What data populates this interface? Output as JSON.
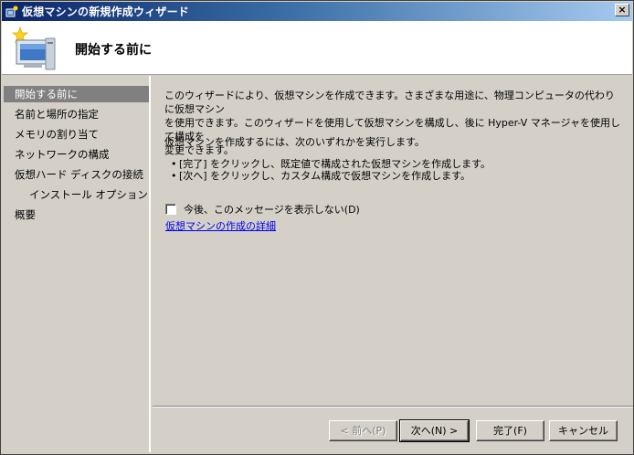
{
  "window": {
    "title": "仮想マシンの新規作成ウィザード",
    "close_label": "×"
  },
  "header": {
    "title": "開始する前に"
  },
  "nav": {
    "items": [
      {
        "label": "開始する前に"
      },
      {
        "label": "名前と場所の指定"
      },
      {
        "label": "メモリの割り当て"
      },
      {
        "label": "ネットワークの構成"
      },
      {
        "label": "仮想ハード ディスクの接続"
      },
      {
        "label": "インストール オプション"
      },
      {
        "label": "概要"
      }
    ]
  },
  "content": {
    "intro_line1": "このウィザードにより、仮想マシンを作成できます。さまざまな用途に、物理コンピュータの代わりに仮想マシン",
    "intro_line2": "を使用できます。このウィザードを使用して仮想マシンを構成し、後に Hyper-V マネージャを使用して構成を",
    "intro_line3": "変更できます。",
    "instruction": "仮想マシンを作成するには、次のいずれかを実行します。",
    "bullets": [
      "[完了] をクリックし、既定値で構成された仮想マシンを作成します。",
      "[次へ] をクリックし、カスタム構成で仮想マシンを作成します。"
    ],
    "checkbox_label": "今後、このメッセージを表示しない(D)",
    "details_link": "仮想マシンの作成の詳細"
  },
  "buttons": {
    "back": "< 前へ(P)",
    "next": "次へ(N) >",
    "finish": "完了(F)",
    "cancel": "キャンセル"
  },
  "colors": {
    "titlebar_start": "#0a246a",
    "titlebar_end": "#a6caf0",
    "face": "#d4d0c8",
    "nav_selected": "#808080",
    "link": "#0000ee"
  },
  "icons": {
    "title_icon": "wizard-app-icon",
    "header_icon": "new-virtual-machine-icon"
  }
}
